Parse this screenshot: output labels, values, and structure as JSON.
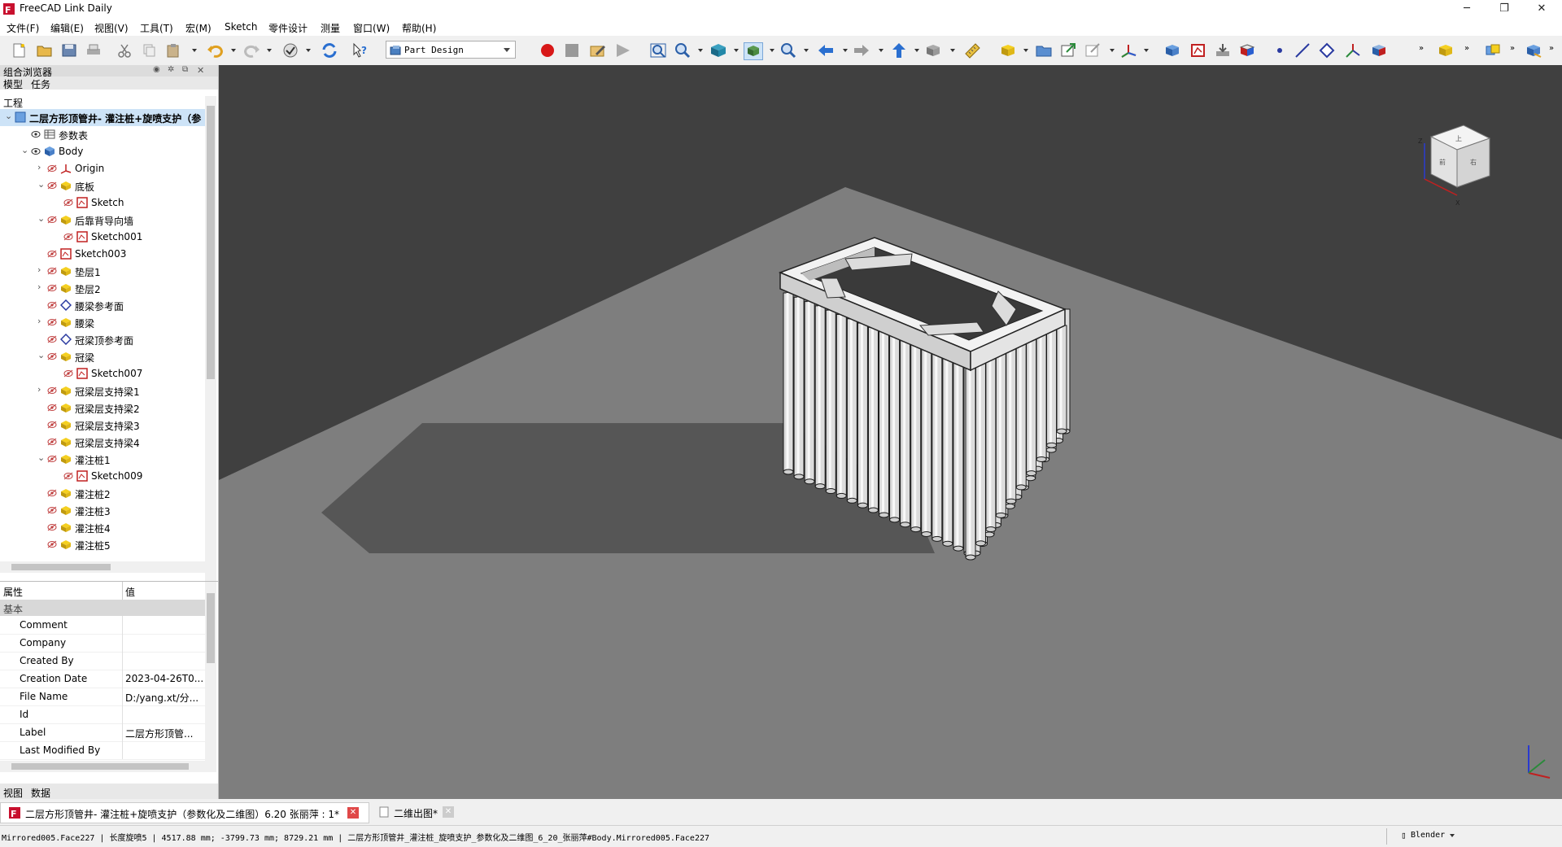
{
  "window": {
    "title": "FreeCAD Link Daily",
    "minimize": "─",
    "restore": "❐",
    "close": "✕"
  },
  "menubar": [
    "文件(F)",
    "编辑(E)",
    "视图(V)",
    "工具(T)",
    "宏(M)",
    "Sketch",
    "零件设计",
    "测量",
    "窗口(W)",
    "帮助(H)"
  ],
  "toolbar": {
    "workbench": "Part Design"
  },
  "combo_view": {
    "title": "组合浏览器",
    "tabs": [
      "模型",
      "任务"
    ],
    "section": "工程",
    "tree": [
      {
        "label": "二层方形顶管井- 灌注桩+旋喷支护（参",
        "level": 0
      },
      {
        "label": "参数表",
        "level": 1
      },
      {
        "label": "Body",
        "level": 1
      },
      {
        "label": "Origin",
        "level": 2
      },
      {
        "label": "底板",
        "level": 2
      },
      {
        "label": "Sketch",
        "level": 3
      },
      {
        "label": "后靠背导向墙",
        "level": 2
      },
      {
        "label": "Sketch001",
        "level": 3
      },
      {
        "label": "Sketch003",
        "level": 2
      },
      {
        "label": "垫层1",
        "level": 2
      },
      {
        "label": "垫层2",
        "level": 2
      },
      {
        "label": "腰梁参考面",
        "level": 2
      },
      {
        "label": "腰梁",
        "level": 2
      },
      {
        "label": "冠梁顶参考面",
        "level": 2
      },
      {
        "label": "冠梁",
        "level": 2
      },
      {
        "label": "Sketch007",
        "level": 3
      },
      {
        "label": "冠梁层支持梁1",
        "level": 2
      },
      {
        "label": "冠梁层支持梁2",
        "level": 2
      },
      {
        "label": "冠梁层支持梁3",
        "level": 2
      },
      {
        "label": "冠梁层支持梁4",
        "level": 2
      },
      {
        "label": "灌注桩1",
        "level": 2
      },
      {
        "label": "Sketch009",
        "level": 3
      },
      {
        "label": "灌注桩2",
        "level": 2
      },
      {
        "label": "灌注桩3",
        "level": 2
      },
      {
        "label": "灌注桩4",
        "level": 2
      },
      {
        "label": "灌注桩5",
        "level": 2
      }
    ]
  },
  "properties": {
    "col_property": "属性",
    "col_value": "值",
    "group": "基本",
    "rows": [
      {
        "key": "Comment",
        "value": ""
      },
      {
        "key": "Company",
        "value": ""
      },
      {
        "key": "Created By",
        "value": ""
      },
      {
        "key": "Creation Date",
        "value": "2023-04-26T0..."
      },
      {
        "key": "File Name",
        "value": "D:/yang.xt/分..."
      },
      {
        "key": "Id",
        "value": ""
      },
      {
        "key": "Label",
        "value": "二层方形顶管..."
      },
      {
        "key": "Last Modified By",
        "value": ""
      }
    ],
    "bottom_tabs": [
      "视图",
      "数据"
    ]
  },
  "navcube": {
    "front": "前",
    "right": "右",
    "top": "上",
    "axis_z": "Z",
    "axis_x": "X"
  },
  "document_tabs": [
    {
      "label": "二层方形顶管井- 灌注桩+旋喷支护（参数化及二维图）6.20 张丽萍 : 1*"
    },
    {
      "label": "二维出图*"
    }
  ],
  "statusbar": {
    "text": "Mirrored005.Face227 | 长度旋喷5 | 4517.88 mm; -3799.73 mm; 8729.21 mm | 二层方形顶管井_灌注桩_旋喷支护_参数化及二维图_6_20_张丽萍#Body.Mirrored005.Face227",
    "nav_style": "Blender"
  },
  "colors": {
    "viewport_bg": "#404040",
    "ground": "#7e7e7e",
    "shadow": "#555555",
    "model": "#e6e6e6",
    "selection": "#cde3f7"
  }
}
